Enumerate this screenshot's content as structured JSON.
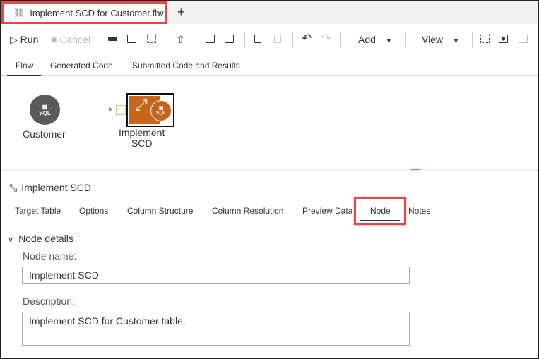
{
  "file_tab": {
    "title": "Implement SCD for Customer.flw",
    "close": "×",
    "icon": "flow-icon"
  },
  "new_tab": "+",
  "toolbar": {
    "run": "Run",
    "cancel": "Cancel",
    "add": "Add",
    "view": "View",
    "caret": "▼"
  },
  "view_tabs": [
    "Flow",
    "Generated Code",
    "Submitted Code and Results"
  ],
  "flow": {
    "nodes": [
      {
        "label": "Customer",
        "badge": "SQL"
      },
      {
        "label_line1": "Implement",
        "label_line2": "SCD",
        "badge": "SQL"
      }
    ]
  },
  "splitter": "....",
  "panel": {
    "title": "Implement SCD",
    "tabs": [
      "Target Table",
      "Options",
      "Column Structure",
      "Column Resolution",
      "Preview Data",
      "Node",
      "Notes"
    ],
    "active_tab": "Node"
  },
  "node_details": {
    "section": "Node details",
    "chevron": "∨",
    "name_label": "Node name:",
    "name_value": "Implement SCD",
    "desc_label": "Description:",
    "desc_value": "Implement SCD for Customer table."
  },
  "colors": {
    "accent": "#c8651b",
    "highlight": "#e8454a",
    "node_gray": "#5a5a5a"
  }
}
